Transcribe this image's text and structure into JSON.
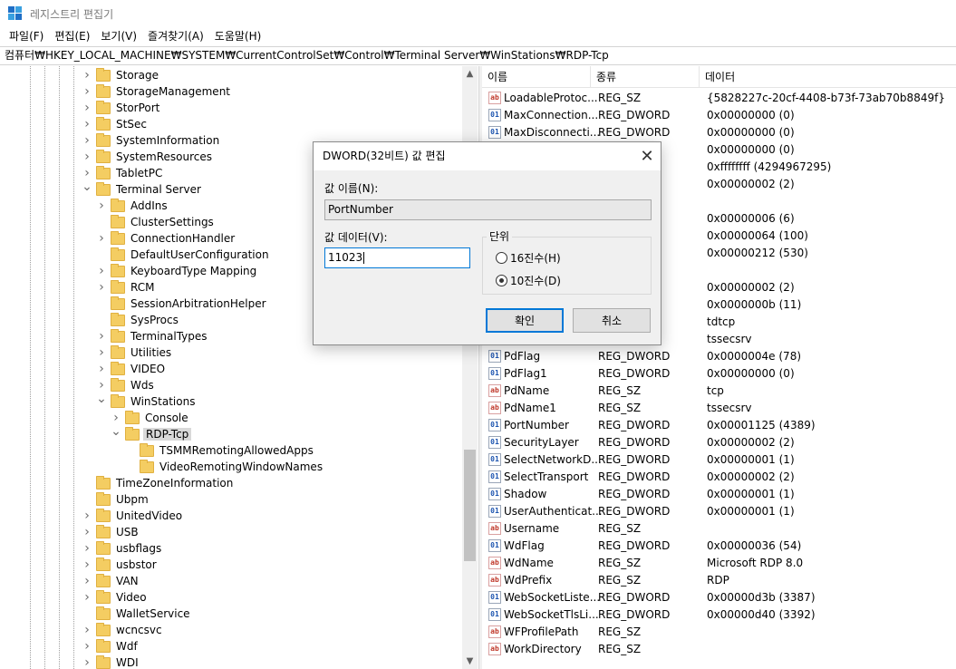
{
  "window": {
    "title": "레지스트리 편집기"
  },
  "menu": [
    "파일(F)",
    "편집(E)",
    "보기(V)",
    "즐겨찾기(A)",
    "도움말(H)"
  ],
  "address": "컴퓨터₩HKEY_LOCAL_MACHINE₩SYSTEM₩CurrentControlSet₩Control₩Terminal Server₩WinStations₩RDP-Tcp",
  "tree": [
    {
      "label": "Storage",
      "depth": 0,
      "state": "collapsed"
    },
    {
      "label": "StorageManagement",
      "depth": 0,
      "state": "collapsed"
    },
    {
      "label": "StorPort",
      "depth": 0,
      "state": "collapsed"
    },
    {
      "label": "StSec",
      "depth": 0,
      "state": "collapsed"
    },
    {
      "label": "SystemInformation",
      "depth": 0,
      "state": "collapsed"
    },
    {
      "label": "SystemResources",
      "depth": 0,
      "state": "collapsed"
    },
    {
      "label": "TabletPC",
      "depth": 0,
      "state": "collapsed"
    },
    {
      "label": "Terminal Server",
      "depth": 0,
      "state": "expanded"
    },
    {
      "label": "AddIns",
      "depth": 1,
      "state": "collapsed"
    },
    {
      "label": "ClusterSettings",
      "depth": 1,
      "state": "leaf"
    },
    {
      "label": "ConnectionHandler",
      "depth": 1,
      "state": "collapsed"
    },
    {
      "label": "DefaultUserConfiguration",
      "depth": 1,
      "state": "leaf"
    },
    {
      "label": "KeyboardType Mapping",
      "depth": 1,
      "state": "collapsed"
    },
    {
      "label": "RCM",
      "depth": 1,
      "state": "collapsed"
    },
    {
      "label": "SessionArbitrationHelper",
      "depth": 1,
      "state": "leaf"
    },
    {
      "label": "SysProcs",
      "depth": 1,
      "state": "leaf"
    },
    {
      "label": "TerminalTypes",
      "depth": 1,
      "state": "collapsed"
    },
    {
      "label": "Utilities",
      "depth": 1,
      "state": "collapsed"
    },
    {
      "label": "VIDEO",
      "depth": 1,
      "state": "collapsed"
    },
    {
      "label": "Wds",
      "depth": 1,
      "state": "collapsed"
    },
    {
      "label": "WinStations",
      "depth": 1,
      "state": "expanded"
    },
    {
      "label": "Console",
      "depth": 2,
      "state": "collapsed"
    },
    {
      "label": "RDP-Tcp",
      "depth": 2,
      "state": "expanded",
      "selected": true
    },
    {
      "label": "TSMMRemotingAllowedApps",
      "depth": 3,
      "state": "leaf"
    },
    {
      "label": "VideoRemotingWindowNames",
      "depth": 3,
      "state": "leaf"
    },
    {
      "label": "TimeZoneInformation",
      "depth": 0,
      "state": "leaf"
    },
    {
      "label": "Ubpm",
      "depth": 0,
      "state": "leaf"
    },
    {
      "label": "UnitedVideo",
      "depth": 0,
      "state": "collapsed"
    },
    {
      "label": "USB",
      "depth": 0,
      "state": "collapsed"
    },
    {
      "label": "usbflags",
      "depth": 0,
      "state": "collapsed"
    },
    {
      "label": "usbstor",
      "depth": 0,
      "state": "collapsed"
    },
    {
      "label": "VAN",
      "depth": 0,
      "state": "collapsed"
    },
    {
      "label": "Video",
      "depth": 0,
      "state": "collapsed"
    },
    {
      "label": "WalletService",
      "depth": 0,
      "state": "leaf"
    },
    {
      "label": "wcncsvc",
      "depth": 0,
      "state": "collapsed"
    },
    {
      "label": "Wdf",
      "depth": 0,
      "state": "collapsed"
    },
    {
      "label": "WDI",
      "depth": 0,
      "state": "collapsed"
    }
  ],
  "list_headers": {
    "name": "이름",
    "type": "종류",
    "data": "데이터"
  },
  "values": [
    {
      "name": "LoadableProtoc...",
      "type": "REG_SZ",
      "data": "{5828227c-20cf-4408-b73f-73ab70b8849f}"
    },
    {
      "name": "MaxConnection...",
      "type": "REG_DWORD",
      "data": "0x00000000 (0)"
    },
    {
      "name": "MaxDisconnecti...",
      "type": "REG_DWORD",
      "data": "0x00000000 (0)"
    },
    {
      "name": "",
      "type": "",
      "data": "0x00000000 (0)"
    },
    {
      "name": "",
      "type": "",
      "data": "0xffffffff (4294967295)"
    },
    {
      "name": "",
      "type": "",
      "data": "0x00000002 (2)"
    },
    {
      "name": "",
      "type": "",
      "data": ""
    },
    {
      "name": "",
      "type": "",
      "data": "0x00000006 (6)"
    },
    {
      "name": "",
      "type": "",
      "data": "0x00000064 (100)"
    },
    {
      "name": "",
      "type": "",
      "data": "0x00000212 (530)"
    },
    {
      "name": "",
      "type": "",
      "data": ""
    },
    {
      "name": "",
      "type": "",
      "data": "0x00000002 (2)"
    },
    {
      "name": "",
      "type": "",
      "data": "0x0000000b (11)"
    },
    {
      "name": "",
      "type": "",
      "data": "tdtcp"
    },
    {
      "name": "",
      "type": "",
      "data": "tssecsrv"
    },
    {
      "name": "PdFlag",
      "type": "REG_DWORD",
      "data": "0x0000004e (78)"
    },
    {
      "name": "PdFlag1",
      "type": "REG_DWORD",
      "data": "0x00000000 (0)"
    },
    {
      "name": "PdName",
      "type": "REG_SZ",
      "data": "tcp"
    },
    {
      "name": "PdName1",
      "type": "REG_SZ",
      "data": "tssecsrv"
    },
    {
      "name": "PortNumber",
      "type": "REG_DWORD",
      "data": "0x00001125 (4389)"
    },
    {
      "name": "SecurityLayer",
      "type": "REG_DWORD",
      "data": "0x00000002 (2)"
    },
    {
      "name": "SelectNetworkD...",
      "type": "REG_DWORD",
      "data": "0x00000001 (1)"
    },
    {
      "name": "SelectTransport",
      "type": "REG_DWORD",
      "data": "0x00000002 (2)"
    },
    {
      "name": "Shadow",
      "type": "REG_DWORD",
      "data": "0x00000001 (1)"
    },
    {
      "name": "UserAuthenticat...",
      "type": "REG_DWORD",
      "data": "0x00000001 (1)"
    },
    {
      "name": "Username",
      "type": "REG_SZ",
      "data": ""
    },
    {
      "name": "WdFlag",
      "type": "REG_DWORD",
      "data": "0x00000036 (54)"
    },
    {
      "name": "WdName",
      "type": "REG_SZ",
      "data": "Microsoft RDP 8.0"
    },
    {
      "name": "WdPrefix",
      "type": "REG_SZ",
      "data": "RDP"
    },
    {
      "name": "WebSocketListe...",
      "type": "REG_DWORD",
      "data": "0x00000d3b (3387)"
    },
    {
      "name": "WebSocketTlsLi...",
      "type": "REG_DWORD",
      "data": "0x00000d40 (3392)"
    },
    {
      "name": "WFProfilePath",
      "type": "REG_SZ",
      "data": ""
    },
    {
      "name": "WorkDirectory",
      "type": "REG_SZ",
      "data": ""
    }
  ],
  "dialog": {
    "title": "DWORD(32비트) 값 편집",
    "name_label": "값 이름(N):",
    "name_value": "PortNumber",
    "data_label": "값 데이터(V):",
    "data_value": "11023",
    "base_label": "단위",
    "hex_label": "16진수(H)",
    "dec_label": "10진수(D)",
    "selected_base": "decimal",
    "ok_label": "확인",
    "cancel_label": "취소"
  },
  "colors": {
    "accent": "#0078d7",
    "folder": "#f4cd62",
    "selection": "#d9d9d9"
  }
}
